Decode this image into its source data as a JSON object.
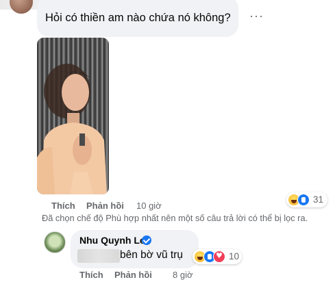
{
  "comment_1": {
    "text": "Hỏi có thiền am nào chứa nó không?",
    "more_icon": "more-horizontal-icon",
    "actions": {
      "like": "Thích",
      "reply": "Phản hồi",
      "time": "10 giờ"
    },
    "reactions": {
      "icons": [
        "haha",
        "like"
      ],
      "count": "31"
    }
  },
  "filter_notice": "Đã chọn chế độ Phù hợp nhất nên một số câu trả lời có thể bị lọc ra.",
  "reply_1": {
    "author": "Nhu Quynh Le",
    "verified": true,
    "text": "bên bờ vũ trụ",
    "actions": {
      "like": "Thích",
      "reply": "Phản hồi",
      "time": "8 giờ"
    },
    "reactions": {
      "icons": [
        "haha",
        "like",
        "love"
      ],
      "count": "10"
    }
  },
  "colors": {
    "bubble": "#f0f2f5",
    "secondary_text": "#65676b",
    "like_blue": "#1877f2",
    "love_red": "#f33e58",
    "haha_yellow": "#f7b125"
  }
}
